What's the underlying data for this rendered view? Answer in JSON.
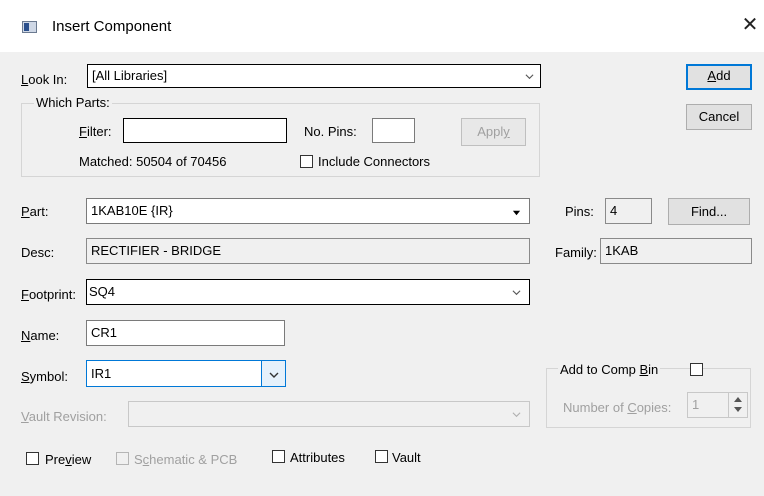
{
  "window": {
    "title": "Insert Component",
    "close_glyph": "✕"
  },
  "look_in": {
    "label_u": "L",
    "label_rest": "ook In:",
    "value": "[All Libraries]"
  },
  "which_parts": {
    "legend": "Which Parts:",
    "filter_label_u": "F",
    "filter_label_rest": "ilter:",
    "filter_value": "",
    "no_pins_label": "No. Pins:",
    "no_pins_value": "",
    "apply_label_pre": "Appl",
    "apply_label_u": "y",
    "matched_text": "Matched: 50504 of 70456",
    "include_connectors_label": "Include Connectors",
    "include_connectors_checked": false
  },
  "buttons": {
    "add_u": "A",
    "add_rest": "dd",
    "cancel": "Cancel",
    "find": "Find..."
  },
  "part": {
    "label_u": "P",
    "label_rest": "art:",
    "value": "1KAB10E {IR}"
  },
  "pins": {
    "label": "Pins:",
    "value": "4"
  },
  "desc": {
    "label": "Desc:",
    "value": "RECTIFIER - BRIDGE"
  },
  "family": {
    "label": "Family:",
    "value": "1KAB"
  },
  "footprint": {
    "label_u": "F",
    "label_rest": "ootprint:",
    "value": "SQ4"
  },
  "name": {
    "label_u": "N",
    "label_rest": "ame:",
    "value": "CR1"
  },
  "symbol": {
    "label_u": "S",
    "label_rest": "ymbol:",
    "value": "IR1"
  },
  "add_to_comp_bin": {
    "label_pre": "Add to Comp ",
    "label_u": "B",
    "label_rest": "in",
    "checked": false
  },
  "copies": {
    "label_pre": "Number of ",
    "label_u": "C",
    "label_rest": "opies:",
    "value": "1"
  },
  "vault_revision": {
    "label_u": "V",
    "label_rest": "ault Revision:",
    "value": ""
  },
  "options": {
    "preview_pre": "Pre",
    "preview_u": "v",
    "preview_rest": "iew",
    "preview_checked": false,
    "schematic_pre": "S",
    "schematic_u": "c",
    "schematic_rest": "hematic & PCB",
    "schematic_checked": false,
    "attributes": "Attributes",
    "attributes_checked": false,
    "vault": "Vault",
    "vault_checked": false
  },
  "colors": {
    "default_button_border": "#0078d7",
    "disabled_text": "#a0a0a0",
    "focus_accent": "#0078d7"
  }
}
